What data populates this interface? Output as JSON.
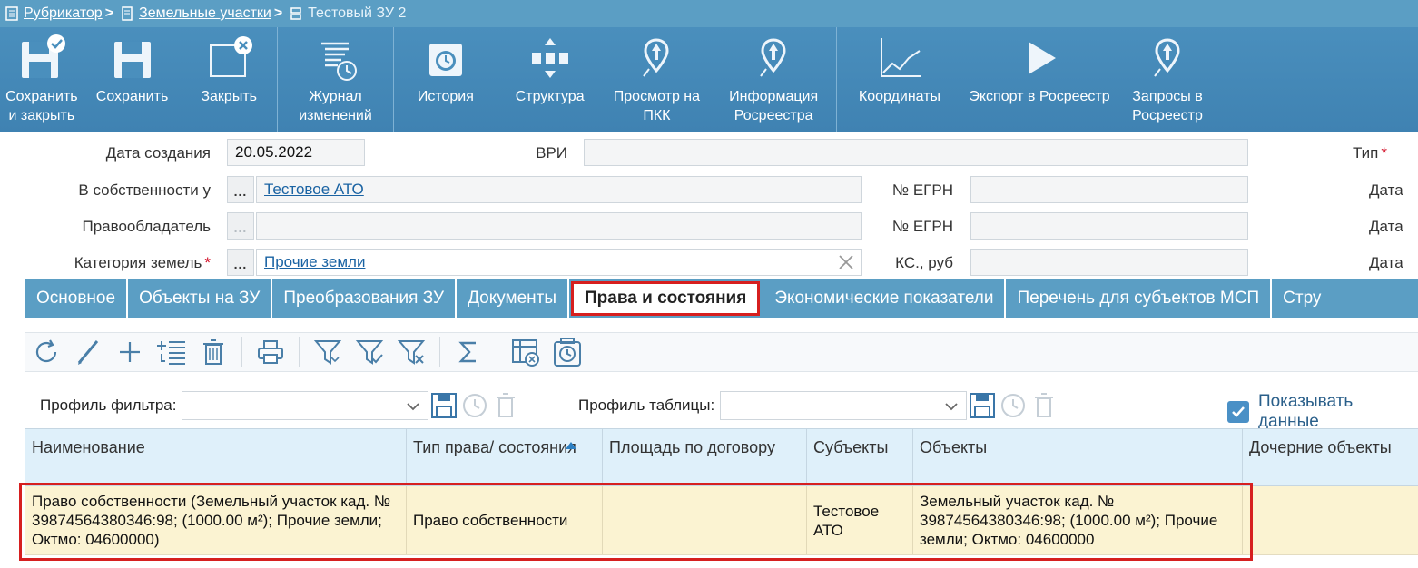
{
  "breadcrumb": {
    "items": [
      "Рубрикатор",
      "Земельные участки"
    ],
    "current": "Тестовый ЗУ 2",
    "separator": ">"
  },
  "toolbar": {
    "groups": [
      [
        {
          "label": "Сохранить\nи закрыть",
          "icon": "save-and-close-icon"
        },
        {
          "label": "Сохранить",
          "icon": "save-icon"
        },
        {
          "label": "Закрыть",
          "icon": "close-window-icon"
        }
      ],
      [
        {
          "label": "Журнал\nизменений",
          "icon": "change-log-icon"
        }
      ],
      [
        {
          "label": "История",
          "icon": "history-icon"
        },
        {
          "label": "Структура",
          "icon": "structure-icon"
        },
        {
          "label": "Просмотр на\nПКК",
          "icon": "map-pin-icon"
        },
        {
          "label": "Информация\nРосреестра",
          "icon": "map-pin-icon"
        }
      ],
      [
        {
          "label": "Координаты",
          "icon": "coordinates-chart-icon"
        },
        {
          "label": "Экспорт в Росреестр",
          "icon": "play-icon"
        },
        {
          "label": "Запросы в\nРосреестр",
          "icon": "map-pin-icon"
        }
      ]
    ]
  },
  "form": {
    "created_label": "Дата создания",
    "created_value": "20.05.2022",
    "owner_label": "В собственности у",
    "owner_value": "Тестовое АТО",
    "holder_label": "Правообладатель",
    "holder_value": "",
    "category_label": "Категория земель",
    "category_value": "Прочие земли",
    "vri_label": "ВРИ",
    "egrn1_label": "№ ЕГРН",
    "egrn2_label": "№ ЕГРН",
    "ks_label": "КС., руб",
    "type_label": "Тип",
    "date1_label": "Дата",
    "date2_label": "Дата",
    "date3_label": "Дата",
    "dots": "..."
  },
  "tabs": [
    {
      "label": "Основное",
      "active": false
    },
    {
      "label": "Объекты на ЗУ",
      "active": false
    },
    {
      "label": "Преобразования ЗУ",
      "active": false
    },
    {
      "label": "Документы",
      "active": false
    },
    {
      "label": "Права и состояния",
      "active": true
    },
    {
      "label": "Экономические показатели",
      "active": false
    },
    {
      "label": "Перечень для субъектов МСП",
      "active": false
    },
    {
      "label": "Стру",
      "active": false
    }
  ],
  "profiles": {
    "filter_label": "Профиль фильтра:",
    "filter_value": "",
    "table_label": "Профиль таблицы:",
    "table_value": "",
    "show_data_label": "Показывать данные",
    "show_data_checked": true
  },
  "table": {
    "columns": [
      "Наименование",
      "Тип права/ состояния",
      "Площадь по договору",
      "Субъекты",
      "Объекты",
      "Дочерние объекты"
    ],
    "rows": [
      [
        "Право собственности (Земельный участок кад. № 39874564380346:98; (1000.00 м²); Прочие земли; Октмо: 04600000)",
        "Право собственности",
        "",
        "Тестовое АТО",
        "Земельный участок кад. № 39874564380346:98; (1000.00 м²); Прочие земли; Октмо: 04600000",
        ""
      ]
    ]
  },
  "colors": {
    "accent": "#5b9ec4",
    "toolbar": "#4387b6",
    "highlight_row": "#fbf3d2",
    "annotation": "#d61f1f"
  }
}
